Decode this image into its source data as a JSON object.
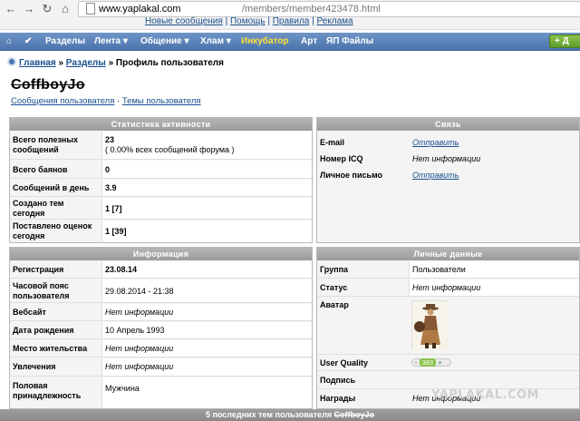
{
  "browser": {
    "url_host": "www.yaplakal.com",
    "url_path": "/members/member423478.html"
  },
  "top_links": [
    "Новые сообщения",
    "Помощь",
    "Правила",
    "Реклама"
  ],
  "menu": {
    "items": [
      {
        "label": "Разделы",
        "dropdown": false
      },
      {
        "label": "Лента",
        "dropdown": true
      },
      {
        "label": "Общение",
        "dropdown": true
      },
      {
        "label": "Хлам",
        "dropdown": true
      },
      {
        "label": "Инкубатор",
        "dropdown": false,
        "highlight": true
      },
      {
        "label": "Арт",
        "dropdown": false
      },
      {
        "label": "ЯП Файлы",
        "dropdown": false
      }
    ],
    "add_label": "Д",
    "highlight_color": "#ffe23a"
  },
  "breadcrumb": {
    "home": "Главная",
    "sep1": "»",
    "sections": "Разделы",
    "sep2": "»",
    "current": "Профиль пользователя"
  },
  "user": {
    "name": "CoffboyJo",
    "posts_link": "Сообщения пользователя",
    "sep": "·",
    "topics_link": "Темы пользователя"
  },
  "activity": {
    "title": "Статистика активности",
    "rows": [
      {
        "label": "Всего полезных сообщений",
        "value": "23",
        "extra": "( 0.00% всех сообщений форума )"
      },
      {
        "label": "Всего баянов",
        "value": "0"
      },
      {
        "label": "Сообщений в день",
        "value": "3.9"
      },
      {
        "label": "Создано тем сегодня",
        "value": "1 [7]"
      },
      {
        "label": "Поставлено оценок сегодня",
        "value": "1 [39]"
      }
    ]
  },
  "contact": {
    "title": "Связь",
    "rows": [
      {
        "label": "E-mail",
        "value": "Отправить"
      },
      {
        "label": "Номер ICQ",
        "value": "Нет информации"
      },
      {
        "label": "Личное письмо",
        "value": "Отправить"
      }
    ]
  },
  "info": {
    "title": "Информация",
    "rows": [
      {
        "label": "Регистрация",
        "value": "23.08.14"
      },
      {
        "label": "Часовой пояс пользователя",
        "value": "29.08.2014 - 21:38"
      },
      {
        "label": "Вебсайт",
        "value": "Нет информации"
      },
      {
        "label": "Дата рождения",
        "value": "10 Апрель 1993"
      },
      {
        "label": "Место жительства",
        "value": "Нет информации"
      },
      {
        "label": "Увлечения",
        "value": "Нет информации"
      },
      {
        "label": "Половая принадлежность",
        "value": "Мужчина"
      }
    ]
  },
  "personal": {
    "title": "Личные данные",
    "rows": [
      {
        "label": "Группа",
        "value": "Пользователи"
      },
      {
        "label": "Статус",
        "value": "Нет информации"
      },
      {
        "label": "Аватар",
        "value": ""
      },
      {
        "label": "User Quality",
        "value": "383",
        "minus": "-",
        "plus": "+"
      },
      {
        "label": "Подпись",
        "value": ""
      },
      {
        "label": "Награды",
        "value": "Нет информации"
      }
    ]
  },
  "bottom": {
    "prefix": "5 последних тем пользователя",
    "name": "CoffboyJo"
  },
  "watermark": "YAPLAKAL.COM"
}
